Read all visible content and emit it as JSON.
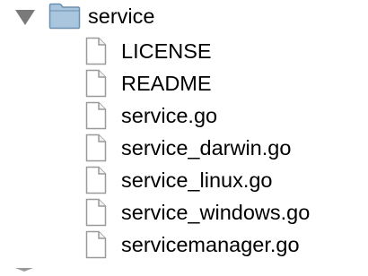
{
  "tree": {
    "folder": {
      "label": "service",
      "expanded": true,
      "icon": "folder-icon"
    },
    "files": [
      {
        "label": "LICENSE",
        "icon": "file-icon"
      },
      {
        "label": "README",
        "icon": "file-icon"
      },
      {
        "label": "service.go",
        "icon": "file-icon"
      },
      {
        "label": "service_darwin.go",
        "icon": "file-icon"
      },
      {
        "label": "service_linux.go",
        "icon": "file-icon"
      },
      {
        "label": "service_windows.go",
        "icon": "file-icon"
      },
      {
        "label": "servicemanager.go",
        "icon": "file-icon"
      }
    ]
  },
  "colors": {
    "disclosure": "#7a7a7a",
    "folder_fill": "#a9c6de",
    "folder_stroke": "#6b8fb0",
    "file_fill": "#ffffff",
    "file_stroke": "#9a9a9a",
    "text": "#000000"
  }
}
